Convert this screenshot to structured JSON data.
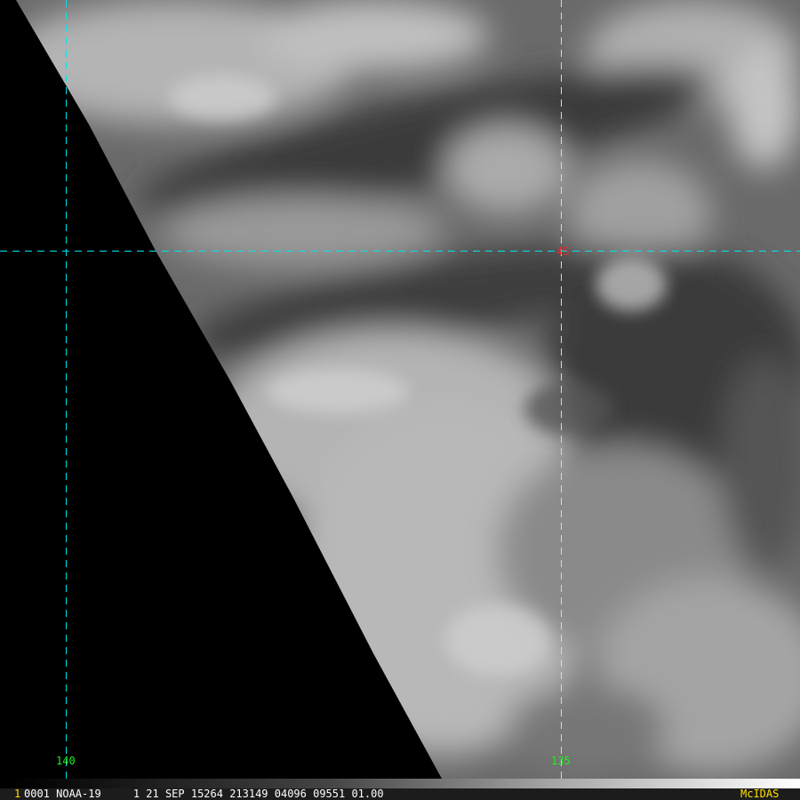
{
  "image": {
    "frame_number": "1",
    "info_line": "0001 NOAA-19     1 21 SEP 15264 213149 04096 09551 01.00",
    "brand": "McIDAS",
    "grid_labels": {
      "lon_west": "140",
      "lon_east": "135",
      "lat": "45"
    },
    "colors": {
      "grid": "#00e5ee",
      "lon_label": "#22ee22",
      "lat_label": "#ff2020",
      "brand": "#ffe000"
    }
  }
}
